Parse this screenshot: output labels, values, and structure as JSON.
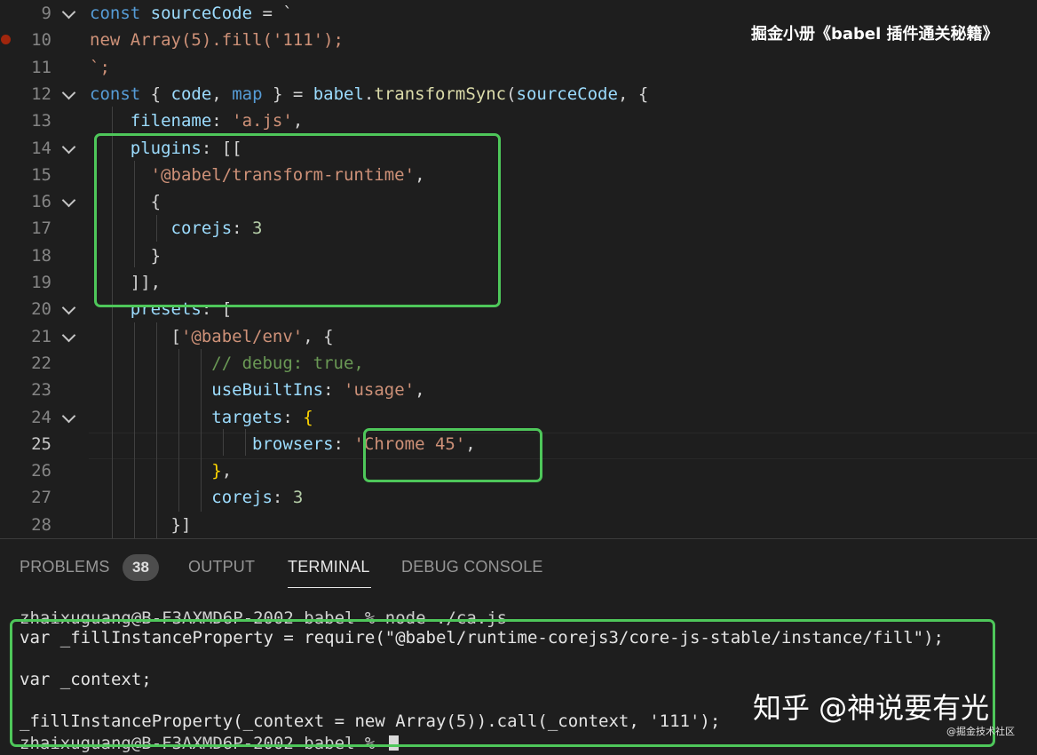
{
  "watermark_top": "掘金小册《babel 插件通关秘籍》",
  "editor": {
    "lines": [
      {
        "num": "9",
        "fold": true,
        "tokens": [
          {
            "t": "const ",
            "c": "k"
          },
          {
            "t": "sourceCode",
            "c": "v"
          },
          {
            "t": " = `",
            "c": "p"
          }
        ]
      },
      {
        "num": "10",
        "fold": false,
        "breakpoint": true,
        "tokens": [
          {
            "t": "new Array(5).fill('111');",
            "c": "s"
          }
        ]
      },
      {
        "num": "11",
        "fold": false,
        "tokens": [
          {
            "t": "`;",
            "c": "s"
          }
        ]
      },
      {
        "num": "12",
        "fold": true,
        "tokens": [
          {
            "t": "const ",
            "c": "k"
          },
          {
            "t": "{ ",
            "c": "p"
          },
          {
            "t": "code",
            "c": "v"
          },
          {
            "t": ", ",
            "c": "p"
          },
          {
            "t": "map",
            "c": "k"
          },
          {
            "t": " } = ",
            "c": "p"
          },
          {
            "t": "babel",
            "c": "v"
          },
          {
            "t": ".",
            "c": "p"
          },
          {
            "t": "transformSync",
            "c": "f"
          },
          {
            "t": "(",
            "c": "p"
          },
          {
            "t": "sourceCode",
            "c": "v"
          },
          {
            "t": ", {",
            "c": "p"
          }
        ]
      },
      {
        "num": "13",
        "fold": false,
        "tokens": [
          {
            "t": "    ",
            "c": "p"
          },
          {
            "t": "filename",
            "c": "v"
          },
          {
            "t": ": ",
            "c": "p"
          },
          {
            "t": "'a.js'",
            "c": "s"
          },
          {
            "t": ",",
            "c": "p"
          }
        ]
      },
      {
        "num": "14",
        "fold": true,
        "tokens": [
          {
            "t": "    ",
            "c": "p"
          },
          {
            "t": "plugins",
            "c": "v"
          },
          {
            "t": ": [[",
            "c": "p"
          }
        ]
      },
      {
        "num": "15",
        "fold": false,
        "tokens": [
          {
            "t": "      ",
            "c": "p"
          },
          {
            "t": "'@babel/transform-runtime'",
            "c": "s"
          },
          {
            "t": ",",
            "c": "p"
          }
        ]
      },
      {
        "num": "16",
        "fold": true,
        "tokens": [
          {
            "t": "      {",
            "c": "p"
          }
        ]
      },
      {
        "num": "17",
        "fold": false,
        "tokens": [
          {
            "t": "        ",
            "c": "p"
          },
          {
            "t": "corejs",
            "c": "v"
          },
          {
            "t": ": ",
            "c": "p"
          },
          {
            "t": "3",
            "c": "n"
          }
        ]
      },
      {
        "num": "18",
        "fold": false,
        "tokens": [
          {
            "t": "      }",
            "c": "p"
          }
        ]
      },
      {
        "num": "19",
        "fold": false,
        "tokens": [
          {
            "t": "    ]],",
            "c": "p"
          }
        ]
      },
      {
        "num": "20",
        "fold": true,
        "tokens": [
          {
            "t": "    ",
            "c": "p"
          },
          {
            "t": "presets",
            "c": "v"
          },
          {
            "t": ": [",
            "c": "p"
          }
        ]
      },
      {
        "num": "21",
        "fold": true,
        "tokens": [
          {
            "t": "        [",
            "c": "p"
          },
          {
            "t": "'@babel/env'",
            "c": "s"
          },
          {
            "t": ", {",
            "c": "p"
          }
        ]
      },
      {
        "num": "22",
        "fold": false,
        "tokens": [
          {
            "t": "            ",
            "c": "p"
          },
          {
            "t": "// debug: true,",
            "c": "c"
          }
        ]
      },
      {
        "num": "23",
        "fold": false,
        "tokens": [
          {
            "t": "            ",
            "c": "p"
          },
          {
            "t": "useBuiltIns",
            "c": "v"
          },
          {
            "t": ": ",
            "c": "p"
          },
          {
            "t": "'usage'",
            "c": "s"
          },
          {
            "t": ",",
            "c": "p"
          }
        ]
      },
      {
        "num": "24",
        "fold": true,
        "tokens": [
          {
            "t": "            ",
            "c": "p"
          },
          {
            "t": "targets",
            "c": "v"
          },
          {
            "t": ": ",
            "c": "p"
          },
          {
            "t": "{",
            "c": "y"
          }
        ]
      },
      {
        "num": "25",
        "fold": false,
        "current": true,
        "tokens": [
          {
            "t": "                ",
            "c": "p"
          },
          {
            "t": "browsers",
            "c": "v"
          },
          {
            "t": ": ",
            "c": "p"
          },
          {
            "t": "'Chrome 45'",
            "c": "s"
          },
          {
            "t": ",",
            "c": "p"
          }
        ]
      },
      {
        "num": "26",
        "fold": false,
        "tokens": [
          {
            "t": "            ",
            "c": "p"
          },
          {
            "t": "}",
            "c": "y"
          },
          {
            "t": ",",
            "c": "p"
          }
        ]
      },
      {
        "num": "27",
        "fold": false,
        "tokens": [
          {
            "t": "            ",
            "c": "p"
          },
          {
            "t": "corejs",
            "c": "v"
          },
          {
            "t": ": ",
            "c": "p"
          },
          {
            "t": "3",
            "c": "n"
          }
        ]
      },
      {
        "num": "28",
        "fold": false,
        "tokens": [
          {
            "t": "        }]",
            "c": "p"
          }
        ]
      }
    ]
  },
  "panel": {
    "tabs": [
      {
        "label": "PROBLEMS",
        "active": false
      },
      {
        "label": "OUTPUT",
        "active": false
      },
      {
        "label": "TERMINAL",
        "active": true
      },
      {
        "label": "DEBUG CONSOLE",
        "active": false
      }
    ],
    "problems_count": "38",
    "terminal_lines": [
      "zhaixuguang@B-F3AXMD6P-2002 babel % node ./ca.js",
      "var _fillInstanceProperty = require(\"@babel/runtime-corejs3/core-js-stable/instance/fill\");",
      "",
      "var _context;",
      "",
      "_fillInstanceProperty(_context = new Array(5)).call(_context, '111');",
      "zhaixuguang@B-F3AXMD6P-2002 babel % "
    ]
  },
  "watermark_bottom": "知乎 @神说要有光",
  "watermark_small": "@掘金技术社区",
  "colors": {
    "highlight_box": "#4ec75a",
    "editor_bg": "#1e1e1e"
  }
}
